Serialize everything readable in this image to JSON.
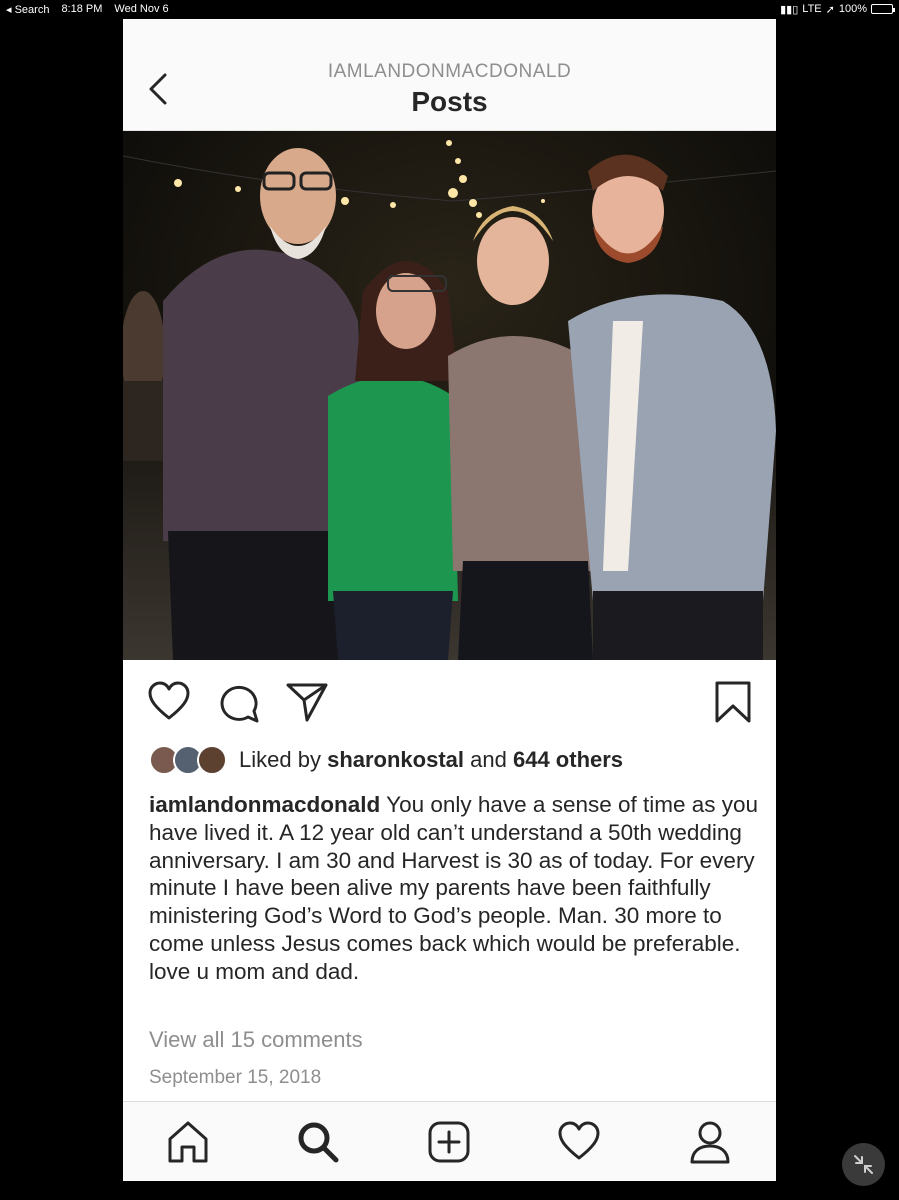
{
  "status_bar": {
    "back_app": "◂ Search",
    "time": "8:18 PM",
    "date": "Wed Nov 6",
    "network": "LTE",
    "battery": "100%"
  },
  "header": {
    "username": "IAMLANDONMACDONALD",
    "title": "Posts"
  },
  "post": {
    "liked_by_prefix": "Liked by",
    "liked_by_user": "sharonkostal",
    "liked_by_and": "and",
    "liked_by_others": "644 others",
    "author": "iamlandonmacdonald",
    "caption": " You only have a sense of time as you have lived it. A 12 year old can’t understand a 50th wedding anniversary. I am 30 and Harvest is 30 as of today. For every minute I have been alive my parents have been faithfully ministering God’s Word to God’s people. Man. 30 more to come unless Jesus comes back which would be preferable. love u mom and dad.",
    "view_comments": "View all 15 comments",
    "date": "September 15, 2018"
  },
  "icons": {
    "actions": [
      "heart-icon",
      "comment-icon",
      "share-icon",
      "bookmark-icon"
    ],
    "tabs": [
      "home-icon",
      "search-icon",
      "add-post-icon",
      "activity-heart-icon",
      "profile-icon"
    ]
  }
}
